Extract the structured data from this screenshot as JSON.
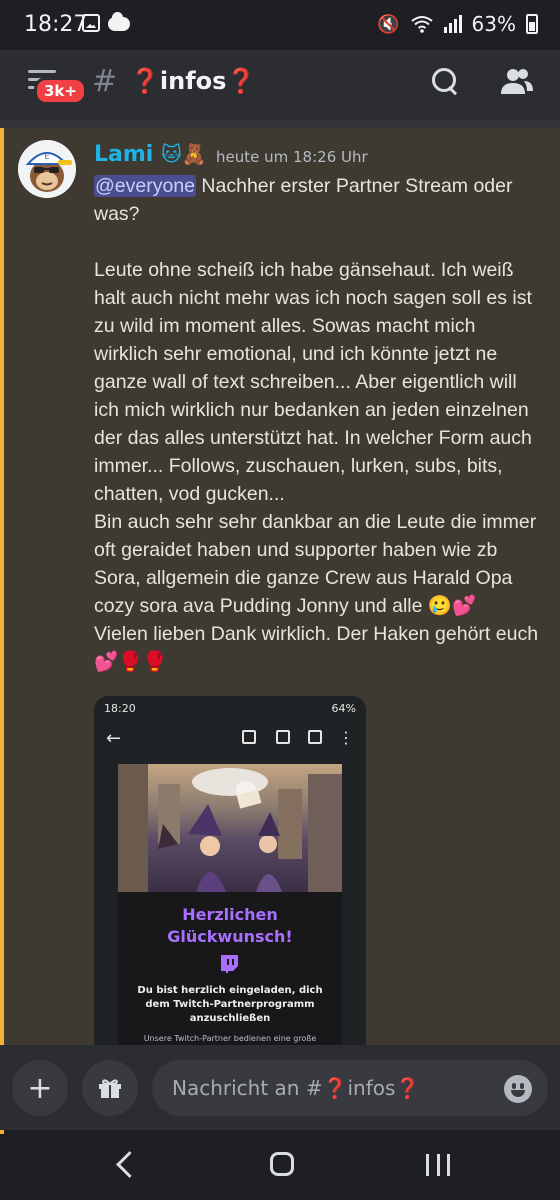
{
  "status_bar": {
    "time": "18:27",
    "battery": "63%",
    "icons": [
      "gallery-icon",
      "cloud-icon",
      "mute-icon",
      "wifi-icon",
      "signal-icon",
      "battery-icon"
    ]
  },
  "header": {
    "unread_badge": "3k+",
    "hash": "#",
    "channel_prefix": "❓",
    "channel_name": "infos",
    "channel_suffix": "❓",
    "icons": [
      "menu-icon",
      "search-icon",
      "members-icon"
    ]
  },
  "message": {
    "username": "Lami",
    "username_emojis": "🐱🧸",
    "timestamp": "heute um 18:26 Uhr",
    "mention": "@everyone",
    "text_first_line": " Nachher erster Partner Stream oder was?",
    "text_body": "Leute ohne scheiß ich habe gänsehaut. Ich weiß halt auch nicht mehr was ich noch sagen soll es ist zu wild im moment alles. Sowas macht mich wirklich sehr emotional, und ich könnte jetzt ne ganze wall of text schreiben... Aber eigentlich will ich mich wirklich nur bedanken an jeden einzelnen der das alles unterstützt hat. In welcher Form auch immer... Follows, zuschauen, lurken, subs, bits, chatten, vod gucken...\nBin auch sehr sehr dankbar an die Leute die immer oft geraidet haben und supporter haben wie zb Sora, allgemein die ganze Crew aus Harald Opa cozy sora ava Pudding Jonny und alle 🥲💕\nVielen lieben Dank wirklich. Der Haken gehört euch\n💕🥊🥊",
    "accent_color": "#f0b232",
    "username_color": "#1eb4e6"
  },
  "attachment": {
    "status_time": "18:20",
    "status_battery": "64%",
    "headline": "Herzlichen Glückwunsch!",
    "subtext": "Du bist herzlich eingeladen, dich dem Twitch-Partnerprogramm anzuschließen",
    "footer_text": "Unsere Twitch-Partner bedienen eine große",
    "accent_color": "#a970ff"
  },
  "input": {
    "placeholder": "Nachricht an #❓infos❓",
    "icons": [
      "plus-icon",
      "gift-icon",
      "emoji-icon"
    ]
  },
  "navbar": {
    "icons": [
      "back-icon",
      "home-icon",
      "recent-apps-icon"
    ]
  }
}
